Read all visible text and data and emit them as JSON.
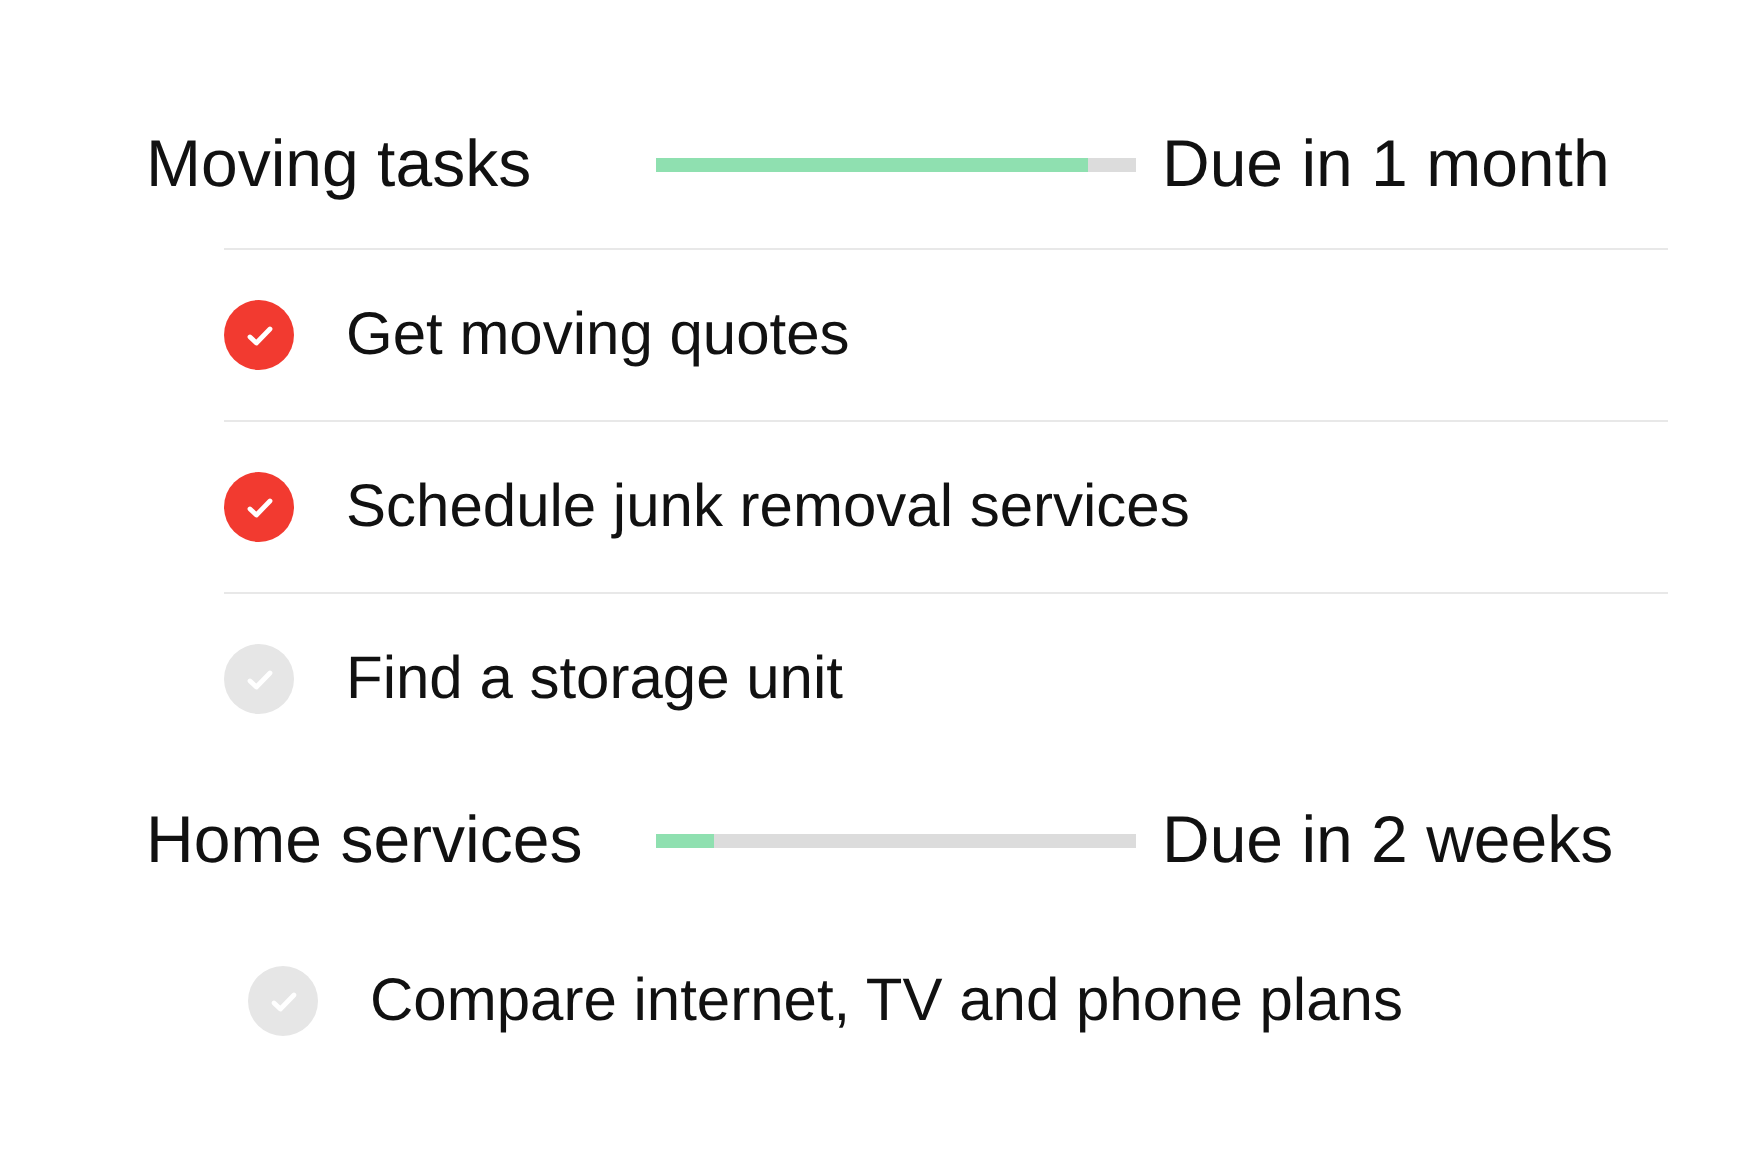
{
  "sections": [
    {
      "title": "Moving tasks",
      "progress": {
        "level": 0.9
      },
      "due": "Due in 1 month",
      "tasks": [
        {
          "label": "Get moving quotes",
          "checked": true
        },
        {
          "label": "Schedule junk removal services",
          "checked": true
        },
        {
          "label": "Find a storage unit",
          "checked": false
        }
      ]
    },
    {
      "title": "Home services",
      "progress": {
        "level": 0.12
      },
      "due": "Due in 2 weeks",
      "tasks": [
        {
          "label": "Compare internet, TV and phone plans",
          "checked": false
        }
      ]
    }
  ]
}
